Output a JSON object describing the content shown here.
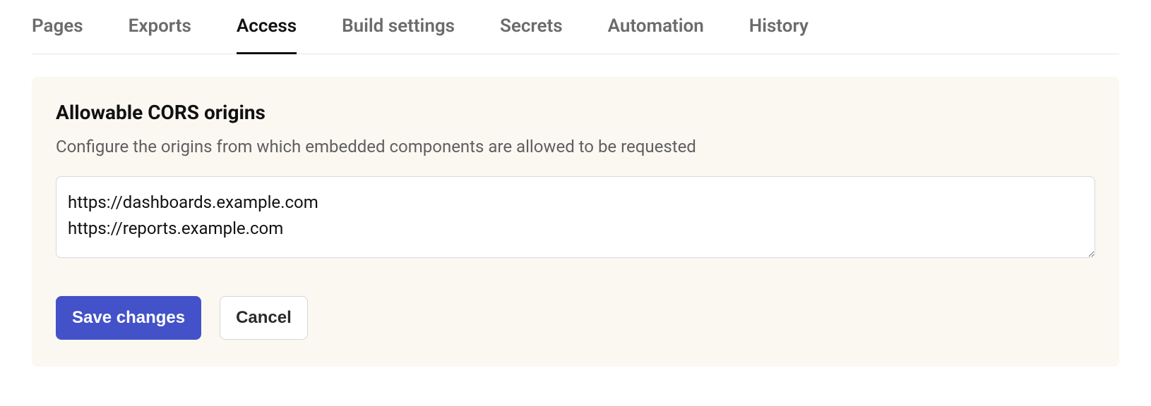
{
  "tabs": [
    {
      "label": "Pages",
      "active": false
    },
    {
      "label": "Exports",
      "active": false
    },
    {
      "label": "Access",
      "active": true
    },
    {
      "label": "Build settings",
      "active": false
    },
    {
      "label": "Secrets",
      "active": false
    },
    {
      "label": "Automation",
      "active": false
    },
    {
      "label": "History",
      "active": false
    }
  ],
  "panel": {
    "title": "Allowable CORS origins",
    "description": "Configure the origins from which embedded components are allowed to be requested",
    "cors_value": "https://dashboards.example.com\nhttps://reports.example.com",
    "save_label": "Save changes",
    "cancel_label": "Cancel"
  }
}
